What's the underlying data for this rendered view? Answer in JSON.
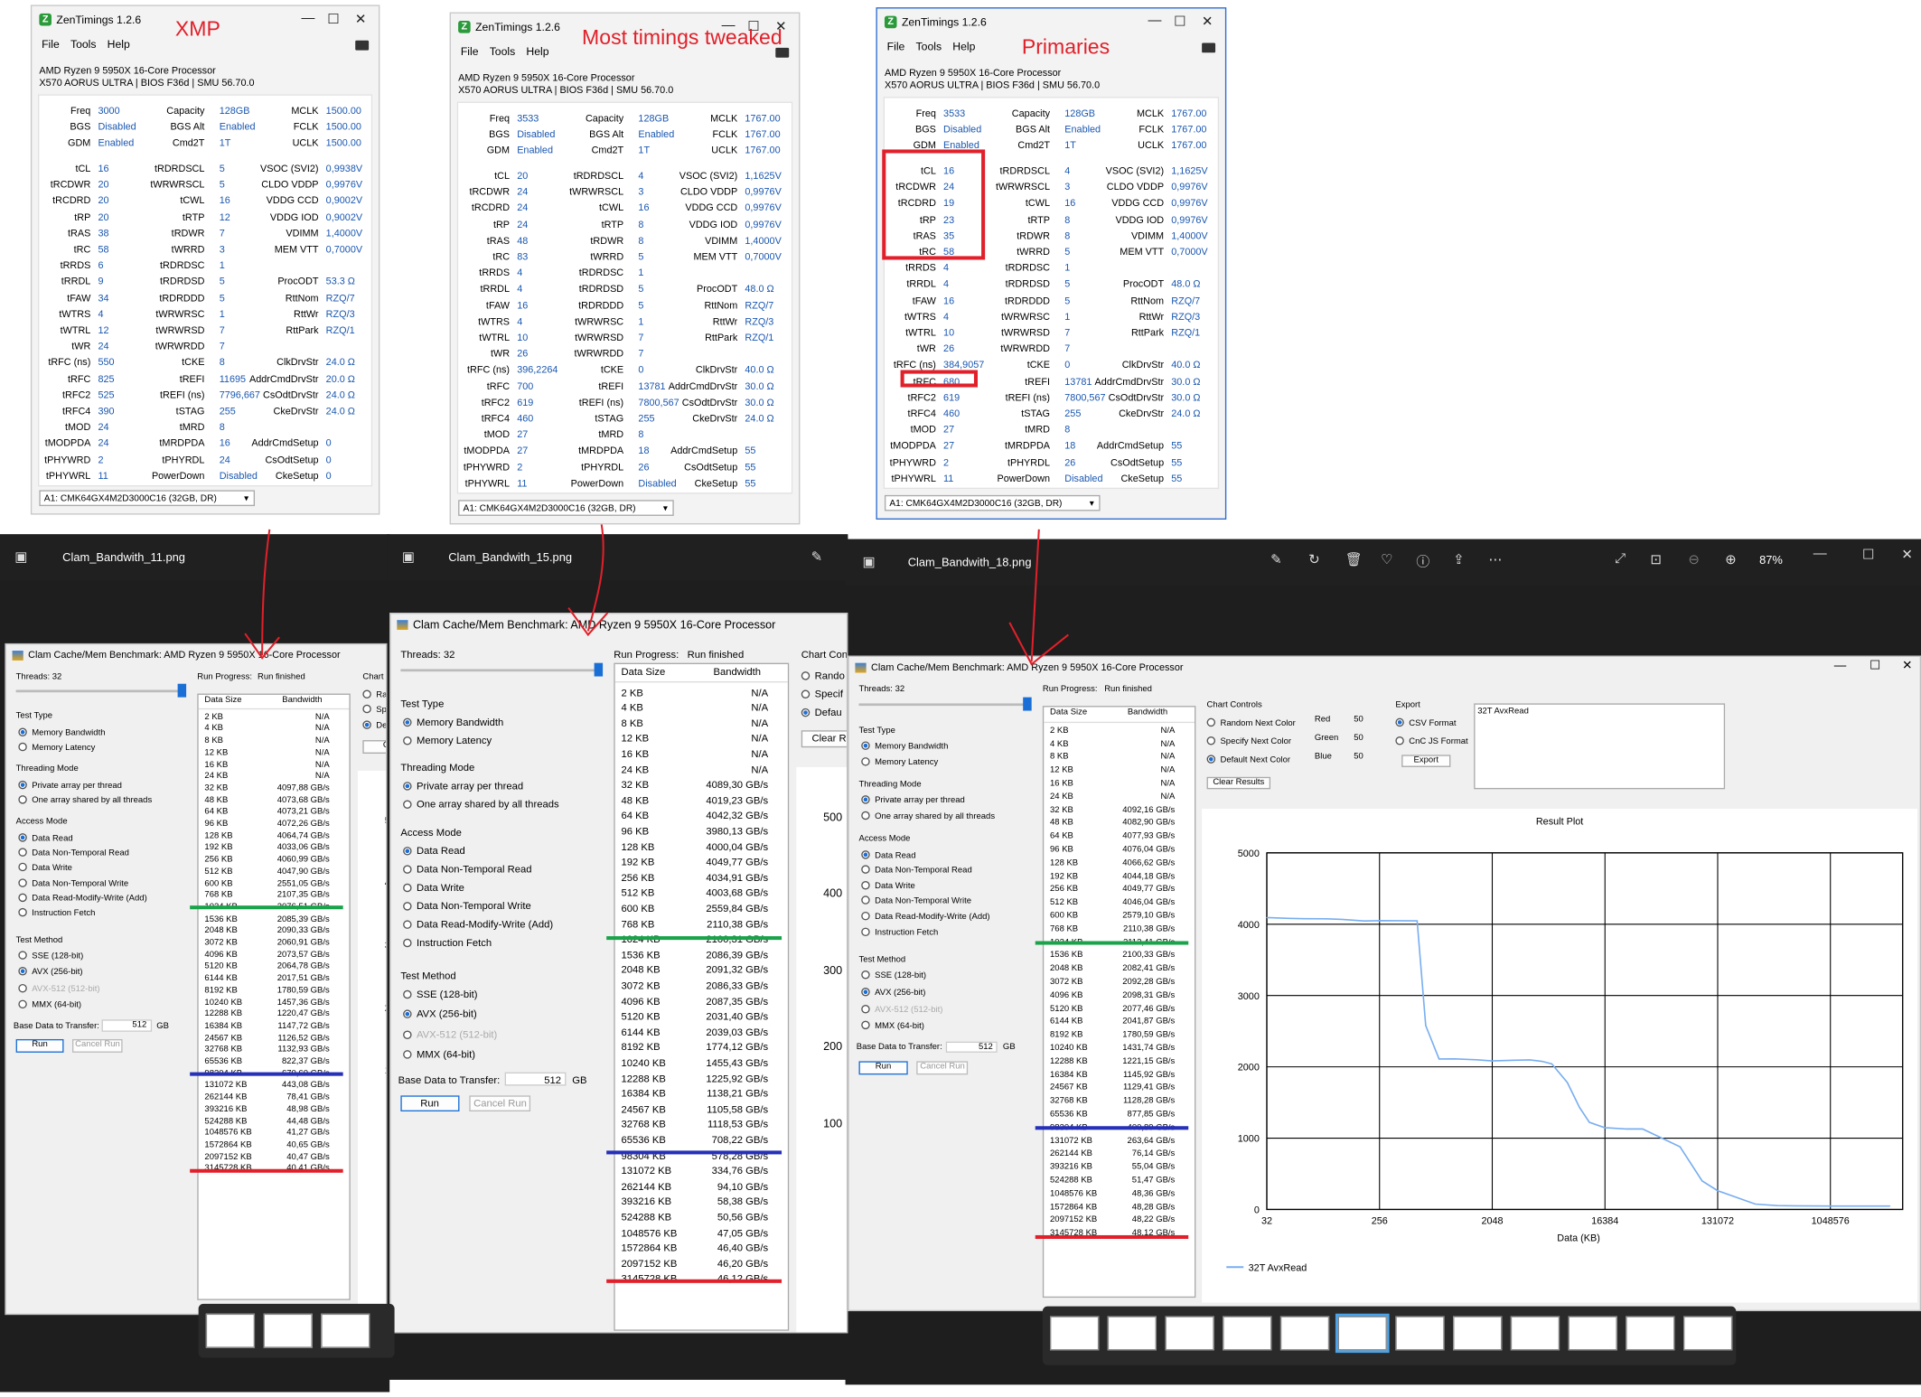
{
  "zentimings": [
    {
      "title": "ZenTimings 1.2.6",
      "annotation": "XMP",
      "menu": [
        "File",
        "Tools",
        "Help"
      ],
      "cpu": "AMD Ryzen 9 5950X 16-Core Processor",
      "board": "X570 AORUS ULTRA | BIOS F36d | SMU 56.70.0",
      "top": [
        [
          "Freq",
          "3000",
          "Capacity",
          "128GB",
          "MCLK",
          "1500.00"
        ],
        [
          "BGS",
          "Disabled",
          "BGS Alt",
          "Enabled",
          "FCLK",
          "1500.00"
        ],
        [
          "GDM",
          "Enabled",
          "Cmd2T",
          "1T",
          "UCLK",
          "1500.00"
        ]
      ],
      "rows": [
        [
          "tCL",
          "16",
          "tRDRDSCL",
          "5",
          "VSOC (SVI2)",
          "0,9938V"
        ],
        [
          "tRCDWR",
          "20",
          "tWRWRSCL",
          "5",
          "CLDO VDDP",
          "0,9976V"
        ],
        [
          "tRCDRD",
          "20",
          "tCWL",
          "16",
          "VDDG CCD",
          "0,9002V"
        ],
        [
          "tRP",
          "20",
          "tRTP",
          "12",
          "VDDG IOD",
          "0,9002V"
        ],
        [
          "tRAS",
          "38",
          "tRDWR",
          "7",
          "VDIMM",
          "1,4000V"
        ],
        [
          "tRC",
          "58",
          "tWRRD",
          "3",
          "MEM VTT",
          "0,7000V"
        ],
        [
          "tRRDS",
          "6",
          "tRDRDSC",
          "1",
          "",
          ""
        ],
        [
          "tRRDL",
          "9",
          "tRDRDSD",
          "5",
          "ProcODT",
          "53.3 Ω"
        ],
        [
          "tFAW",
          "34",
          "tRDRDDD",
          "5",
          "RttNom",
          "RZQ/7"
        ],
        [
          "tWTRS",
          "4",
          "tWRWRSC",
          "1",
          "RttWr",
          "RZQ/3"
        ],
        [
          "tWTRL",
          "12",
          "tWRWRSD",
          "7",
          "RttPark",
          "RZQ/1"
        ],
        [
          "tWR",
          "24",
          "tWRWRDD",
          "7",
          "",
          ""
        ],
        [
          "tRFC (ns)",
          "550",
          "tCKE",
          "8",
          "ClkDrvStr",
          "24.0 Ω"
        ],
        [
          "tRFC",
          "825",
          "tREFI",
          "11695",
          "AddrCmdDrvStr",
          "20.0 Ω"
        ],
        [
          "tRFC2",
          "525",
          "tREFI (ns)",
          "7796,667",
          "CsOdtDrvStr",
          "24.0 Ω"
        ],
        [
          "tRFC4",
          "390",
          "tSTAG",
          "255",
          "CkeDrvStr",
          "24.0 Ω"
        ],
        [
          "tMOD",
          "24",
          "tMRD",
          "8",
          "",
          ""
        ],
        [
          "tMODPDA",
          "24",
          "tMRDPDA",
          "16",
          "AddrCmdSetup",
          "0"
        ],
        [
          "tPHYWRD",
          "2",
          "tPHYRDL",
          "24",
          "CsOdtSetup",
          "0"
        ],
        [
          "tPHYWRL",
          "11",
          "PowerDown",
          "Disabled",
          "CkeSetup",
          "0"
        ]
      ],
      "dimm": "A1: CMK64GX4M2D3000C16 (32GB, DR)"
    },
    {
      "title": "ZenTimings 1.2.6",
      "annotation": "Most timings tweaked",
      "menu": [
        "File",
        "Tools",
        "Help"
      ],
      "cpu": "AMD Ryzen 9 5950X 16-Core Processor",
      "board": "X570 AORUS ULTRA | BIOS F36d | SMU 56.70.0",
      "top": [
        [
          "Freq",
          "3533",
          "Capacity",
          "128GB",
          "MCLK",
          "1767.00"
        ],
        [
          "BGS",
          "Disabled",
          "BGS Alt",
          "Enabled",
          "FCLK",
          "1767.00"
        ],
        [
          "GDM",
          "Enabled",
          "Cmd2T",
          "1T",
          "UCLK",
          "1767.00"
        ]
      ],
      "rows": [
        [
          "tCL",
          "20",
          "tRDRDSCL",
          "4",
          "VSOC (SVI2)",
          "1,1625V"
        ],
        [
          "tRCDWR",
          "24",
          "tWRWRSCL",
          "3",
          "CLDO VDDP",
          "0,9976V"
        ],
        [
          "tRCDRD",
          "24",
          "tCWL",
          "16",
          "VDDG CCD",
          "0,9976V"
        ],
        [
          "tRP",
          "24",
          "tRTP",
          "8",
          "VDDG IOD",
          "0,9976V"
        ],
        [
          "tRAS",
          "48",
          "tRDWR",
          "8",
          "VDIMM",
          "1,4000V"
        ],
        [
          "tRC",
          "83",
          "tWRRD",
          "5",
          "MEM VTT",
          "0,7000V"
        ],
        [
          "tRRDS",
          "4",
          "tRDRDSC",
          "1",
          "",
          ""
        ],
        [
          "tRRDL",
          "4",
          "tRDRDSD",
          "5",
          "ProcODT",
          "48.0 Ω"
        ],
        [
          "tFAW",
          "16",
          "tRDRDDD",
          "5",
          "RttNom",
          "RZQ/7"
        ],
        [
          "tWTRS",
          "4",
          "tWRWRSC",
          "1",
          "RttWr",
          "RZQ/3"
        ],
        [
          "tWTRL",
          "10",
          "tWRWRSD",
          "7",
          "RttPark",
          "RZQ/1"
        ],
        [
          "tWR",
          "26",
          "tWRWRDD",
          "7",
          "",
          ""
        ],
        [
          "tRFC (ns)",
          "396,2264",
          "tCKE",
          "0",
          "ClkDrvStr",
          "40.0 Ω"
        ],
        [
          "tRFC",
          "700",
          "tREFI",
          "13781",
          "AddrCmdDrvStr",
          "30.0 Ω"
        ],
        [
          "tRFC2",
          "619",
          "tREFI (ns)",
          "7800,567",
          "CsOdtDrvStr",
          "30.0 Ω"
        ],
        [
          "tRFC4",
          "460",
          "tSTAG",
          "255",
          "CkeDrvStr",
          "24.0 Ω"
        ],
        [
          "tMOD",
          "27",
          "tMRD",
          "8",
          "",
          ""
        ],
        [
          "tMODPDA",
          "27",
          "tMRDPDA",
          "18",
          "AddrCmdSetup",
          "55"
        ],
        [
          "tPHYWRD",
          "2",
          "tPHYRDL",
          "26",
          "CsOdtSetup",
          "55"
        ],
        [
          "tPHYWRL",
          "11",
          "PowerDown",
          "Disabled",
          "CkeSetup",
          "55"
        ]
      ],
      "dimm": "A1: CMK64GX4M2D3000C16 (32GB, DR)"
    },
    {
      "title": "ZenTimings 1.2.6",
      "annotation": "Primaries",
      "menu": [
        "File",
        "Tools",
        "Help"
      ],
      "cpu": "AMD Ryzen 9 5950X 16-Core Processor",
      "board": "X570 AORUS ULTRA | BIOS F36d | SMU 56.70.0",
      "top": [
        [
          "Freq",
          "3533",
          "Capacity",
          "128GB",
          "MCLK",
          "1767.00"
        ],
        [
          "BGS",
          "Disabled",
          "BGS Alt",
          "Enabled",
          "FCLK",
          "1767.00"
        ],
        [
          "GDM",
          "Enabled",
          "Cmd2T",
          "1T",
          "UCLK",
          "1767.00"
        ]
      ],
      "rows": [
        [
          "tCL",
          "16",
          "tRDRDSCL",
          "4",
          "VSOC (SVI2)",
          "1,1625V"
        ],
        [
          "tRCDWR",
          "24",
          "tWRWRSCL",
          "3",
          "CLDO VDDP",
          "0,9976V"
        ],
        [
          "tRCDRD",
          "19",
          "tCWL",
          "16",
          "VDDG CCD",
          "0,9976V"
        ],
        [
          "tRP",
          "23",
          "tRTP",
          "8",
          "VDDG IOD",
          "0,9976V"
        ],
        [
          "tRAS",
          "35",
          "tRDWR",
          "8",
          "VDIMM",
          "1,4000V"
        ],
        [
          "tRC",
          "58",
          "tWRRD",
          "5",
          "MEM VTT",
          "0,7000V"
        ],
        [
          "tRRDS",
          "4",
          "tRDRDSC",
          "1",
          "",
          ""
        ],
        [
          "tRRDL",
          "4",
          "tRDRDSD",
          "5",
          "ProcODT",
          "48.0 Ω"
        ],
        [
          "tFAW",
          "16",
          "tRDRDDD",
          "5",
          "RttNom",
          "RZQ/7"
        ],
        [
          "tWTRS",
          "4",
          "tWRWRSC",
          "1",
          "RttWr",
          "RZQ/3"
        ],
        [
          "tWTRL",
          "10",
          "tWRWRSD",
          "7",
          "RttPark",
          "RZQ/1"
        ],
        [
          "tWR",
          "26",
          "tWRWRDD",
          "7",
          "",
          ""
        ],
        [
          "tRFC (ns)",
          "384,9057",
          "tCKE",
          "0",
          "ClkDrvStr",
          "40.0 Ω"
        ],
        [
          "tRFC",
          "680",
          "tREFI",
          "13781",
          "AddrCmdDrvStr",
          "30.0 Ω"
        ],
        [
          "tRFC2",
          "619",
          "tREFI (ns)",
          "7800,567",
          "CsOdtDrvStr",
          "30.0 Ω"
        ],
        [
          "tRFC4",
          "460",
          "tSTAG",
          "255",
          "CkeDrvStr",
          "24.0 Ω"
        ],
        [
          "tMOD",
          "27",
          "tMRD",
          "8",
          "",
          ""
        ],
        [
          "tMODPDA",
          "27",
          "tMRDPDA",
          "18",
          "AddrCmdSetup",
          "55"
        ],
        [
          "tPHYWRD",
          "2",
          "tPHYRDL",
          "26",
          "CsOdtSetup",
          "55"
        ],
        [
          "tPHYWRL",
          "11",
          "PowerDown",
          "Disabled",
          "CkeSetup",
          "55"
        ]
      ],
      "dimm": "A1: CMK64GX4M2D3000C16 (32GB, DR)"
    }
  ],
  "viewers": [
    {
      "file": "Clam_Bandwith_11.png"
    },
    {
      "file": "Clam_Bandwith_15.png"
    },
    {
      "file": "Clam_Bandwith_18.png",
      "zoom": "87%"
    }
  ],
  "bench_common": {
    "title": "Clam Cache/Mem Benchmark: AMD Ryzen 9 5950X 16-Core Processor",
    "threads": "Threads: 32",
    "run_progress": "Run Progress:",
    "run_finished": "Run finished",
    "test_type": "Test Type",
    "tt": [
      "Memory Bandwidth",
      "Memory Latency"
    ],
    "threading": "Threading Mode",
    "thm": [
      "Private array per thread",
      "One array shared by all threads"
    ],
    "access": "Access Mode",
    "am": [
      "Data Read",
      "Data Non-Temporal Read",
      "Data Write",
      "Data Non-Temporal Write",
      "Data Read-Modify-Write (Add)",
      "Instruction Fetch"
    ],
    "method": "Test Method",
    "tm": [
      "SSE (128-bit)",
      "AVX (256-bit)",
      "AVX-512 (512-bit)",
      "MMX (64-bit)"
    ],
    "base": "Base Data to Transfer:",
    "base_val": "512",
    "gb": "GB",
    "run": "Run",
    "cancel": "Cancel Run",
    "col_size": "Data Size",
    "col_bw": "Bandwidth",
    "chart_controls": "Chart Controls",
    "cc": [
      "Random Next Color",
      "Specify Next Color",
      "Default Next Color"
    ],
    "clear": "Clear Results",
    "red": "Red",
    "green": "Green",
    "blue": "Blue",
    "rgb_val": "50",
    "export": "Export",
    "ex": [
      "CSV Format",
      "CnC JS Format"
    ],
    "export_btn": "Export",
    "textbox": "32T AvxRead",
    "result_plot": "Result Plot",
    "xlabel": "Data (KB)",
    "legend": "32T AvxRead"
  },
  "bench_sizes": [
    "2 KB",
    "4 KB",
    "8 KB",
    "12 KB",
    "16 KB",
    "24 KB",
    "32 KB",
    "48 KB",
    "64 KB",
    "96 KB",
    "128 KB",
    "192 KB",
    "256 KB",
    "512 KB",
    "600 KB",
    "768 KB",
    "1024 KB",
    "1536 KB",
    "2048 KB",
    "3072 KB",
    "4096 KB",
    "5120 KB",
    "6144 KB",
    "8192 KB",
    "10240 KB",
    "12288 KB",
    "16384 KB",
    "24567 KB",
    "32768 KB",
    "65536 KB",
    "98304 KB",
    "131072 KB",
    "262144 KB",
    "393216 KB",
    "524288 KB",
    "1048576 KB",
    "1572864 KB",
    "2097152 KB",
    "3145728 KB"
  ],
  "bench": [
    {
      "bw": [
        "N/A",
        "N/A",
        "N/A",
        "N/A",
        "N/A",
        "N/A",
        "4097,88 GB/s",
        "4073,68 GB/s",
        "4073,21 GB/s",
        "4072,26 GB/s",
        "4064,74 GB/s",
        "4033,06 GB/s",
        "4060,99 GB/s",
        "4047,90 GB/s",
        "2551,05 GB/s",
        "2107,35 GB/s",
        "2076,51 GB/s",
        "2085,39 GB/s",
        "2090,33 GB/s",
        "2060,91 GB/s",
        "2073,57 GB/s",
        "2064,78 GB/s",
        "2017,51 GB/s",
        "1780,59 GB/s",
        "1457,36 GB/s",
        "1220,47 GB/s",
        "1147,72 GB/s",
        "1126,52 GB/s",
        "1132,93 GB/s",
        "822,37 GB/s",
        "670,60 GB/s",
        "443,08 GB/s",
        "78,41 GB/s",
        "48,98 GB/s",
        "44,48 GB/s",
        "41,27 GB/s",
        "40,65 GB/s",
        "40,47 GB/s",
        "40,41 GB/s"
      ],
      "chart_ticks": [
        "500",
        "400",
        "300",
        "200",
        "100"
      ],
      "cc_label": "Chart Co",
      "cc_short": [
        "Rand",
        "Spe",
        "Def"
      ],
      "clear_short": "Clear"
    },
    {
      "bw": [
        "N/A",
        "N/A",
        "N/A",
        "N/A",
        "N/A",
        "N/A",
        "4089,30 GB/s",
        "4019,23 GB/s",
        "4042,32 GB/s",
        "3980,13 GB/s",
        "4000,04 GB/s",
        "4049,77 GB/s",
        "4034,91 GB/s",
        "4003,68 GB/s",
        "2559,84 GB/s",
        "2110,38 GB/s",
        "2100,31 GB/s",
        "2086,39 GB/s",
        "2091,32 GB/s",
        "2086,33 GB/s",
        "2087,35 GB/s",
        "2031,40 GB/s",
        "2039,03 GB/s",
        "1774,12 GB/s",
        "1455,43 GB/s",
        "1225,92 GB/s",
        "1138,21 GB/s",
        "1105,58 GB/s",
        "1118,53 GB/s",
        "708,22 GB/s",
        "578,28 GB/s",
        "334,76 GB/s",
        "94,10 GB/s",
        "58,38 GB/s",
        "50,56 GB/s",
        "47,05 GB/s",
        "46,40 GB/s",
        "46,20 GB/s",
        "46,12 GB/s"
      ],
      "chart_ticks": [
        "500",
        "400",
        "300",
        "200",
        "100"
      ],
      "cc_label": "Chart Cont",
      "cc_short": [
        "Rando",
        "Specif",
        "Defau"
      ],
      "clear_short": "Clear Re"
    },
    {
      "bw": [
        "N/A",
        "N/A",
        "N/A",
        "N/A",
        "N/A",
        "N/A",
        "4092,16 GB/s",
        "4082,90 GB/s",
        "4077,93 GB/s",
        "4076,04 GB/s",
        "4066,62 GB/s",
        "4044,18 GB/s",
        "4049,77 GB/s",
        "4046,04 GB/s",
        "2579,10 GB/s",
        "2110,38 GB/s",
        "2112,41 GB/s",
        "2100,33 GB/s",
        "2082,41 GB/s",
        "2092,28 GB/s",
        "2098,31 GB/s",
        "2077,46 GB/s",
        "2041,87 GB/s",
        "1780,59 GB/s",
        "1431,74 GB/s",
        "1221,15 GB/s",
        "1145,92 GB/s",
        "1129,41 GB/s",
        "1128,28 GB/s",
        "877,85 GB/s",
        "400,89 GB/s",
        "263,64 GB/s",
        "76,14 GB/s",
        "55,04 GB/s",
        "51,47 GB/s",
        "48,36 GB/s",
        "48,28 GB/s",
        "48,22 GB/s",
        "48,12 GB/s"
      ]
    }
  ],
  "chart_data": {
    "type": "line",
    "title": "Result Plot",
    "xlabel": "Data (KB)",
    "ylabel": "",
    "x_scale": "log2",
    "xticks": [
      "32",
      "256",
      "2048",
      "16384",
      "131072",
      "1048576"
    ],
    "yticks": [
      "0",
      "1000",
      "2000",
      "3000",
      "4000",
      "5000"
    ],
    "ylim": [
      0,
      5000
    ],
    "series": [
      {
        "name": "32T AvxRead",
        "x": [
          32,
          48,
          64,
          96,
          128,
          192,
          256,
          512,
          600,
          768,
          1024,
          1536,
          2048,
          3072,
          4096,
          5120,
          6144,
          8192,
          10240,
          12288,
          16384,
          24567,
          32768,
          65536,
          98304,
          131072,
          262144,
          393216,
          524288,
          1048576,
          1572864,
          2097152,
          3145728
        ],
        "y": [
          4092.16,
          4082.9,
          4077.93,
          4076.04,
          4066.62,
          4044.18,
          4049.77,
          4046.04,
          2579.1,
          2110.38,
          2112.41,
          2100.33,
          2082.41,
          2092.28,
          2098.31,
          2077.46,
          2041.87,
          1780.59,
          1431.74,
          1221.15,
          1145.92,
          1129.41,
          1128.28,
          877.85,
          400.89,
          263.64,
          76.14,
          55.04,
          51.47,
          48.36,
          48.28,
          48.22,
          48.12
        ]
      }
    ]
  },
  "colors": {
    "annotation": "#e0202a",
    "green_marker": "#1aa34a",
    "blue_marker": "#2630b8",
    "red_marker": "#e0202a",
    "accent": "#1a6fd6",
    "series": "#78aef0"
  }
}
